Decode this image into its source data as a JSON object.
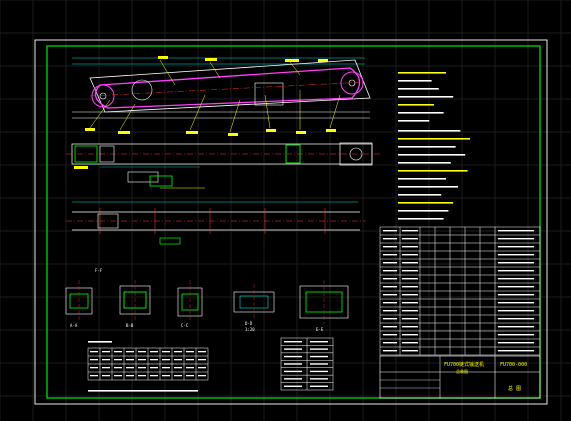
{
  "colors": {
    "background": "#000000",
    "grid": "#1a1a1a",
    "frame_outer": "#e8e8e8",
    "frame_inner": "#00cc00",
    "outline": "#ffffff",
    "belt": "#ff40ff",
    "centerline": "#ff3030",
    "leader": "#ffff00",
    "dimension": "#00e0e0",
    "part": "#00ff00",
    "note_text": "#ffffff",
    "table_line": "#ffffff",
    "title_fill": "#00aa00"
  },
  "labels": {
    "section_a": "A-A",
    "section_b": "B-B",
    "section_c": "C-C",
    "section_d": "D-D",
    "section_e": "E-E",
    "section_f": "F-F",
    "scale": "1:20",
    "title_cell_main": "FU700链式输送机",
    "title_cell_sub": "总装图",
    "drawing_no": "FU700-000",
    "stage": "总 图"
  },
  "icons": {
    "drive_sprocket": "circle-icon",
    "tail_sprocket": "circle-icon"
  }
}
